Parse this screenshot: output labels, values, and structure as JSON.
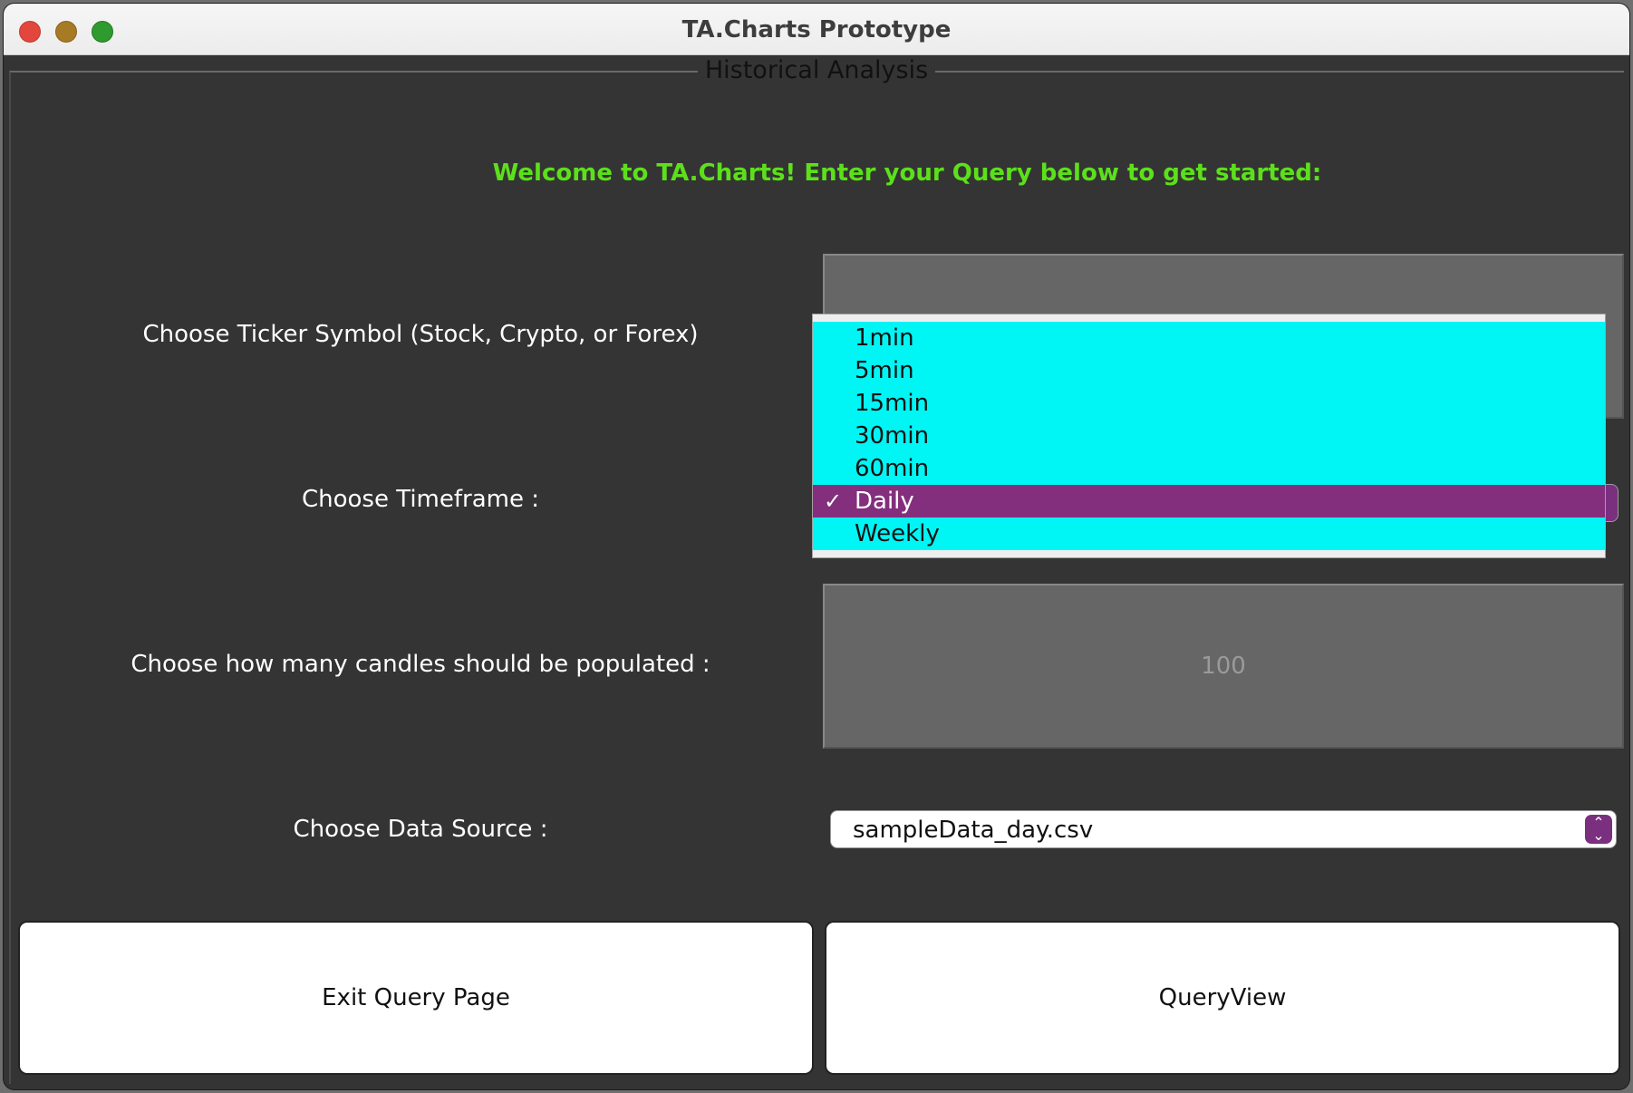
{
  "window": {
    "title": "TA.Charts Prototype"
  },
  "group": {
    "title": "Historical Analysis"
  },
  "welcome_text": "Welcome to TA.Charts! Enter your Query below to get started:",
  "ticker": {
    "label": "Choose Ticker Symbol (Stock, Crypto, or Forex)",
    "value": ""
  },
  "timeframe": {
    "label": "Choose Timeframe :",
    "options": [
      "1min",
      "5min",
      "15min",
      "30min",
      "60min",
      "Daily",
      "Weekly"
    ],
    "selected": "Daily",
    "check_mark": "✓"
  },
  "candles": {
    "label": "Choose how many candles should be populated :",
    "value": "100"
  },
  "data_source": {
    "label": "Choose Data Source :",
    "selected": "sampleData_day.csv"
  },
  "buttons": {
    "exit": "Exit Query Page",
    "query": "QueryView"
  },
  "colors": {
    "welcome": "#5ce01a",
    "popup_item": "#00f5f5",
    "popup_selected": "#832f7d",
    "background": "#343434"
  }
}
